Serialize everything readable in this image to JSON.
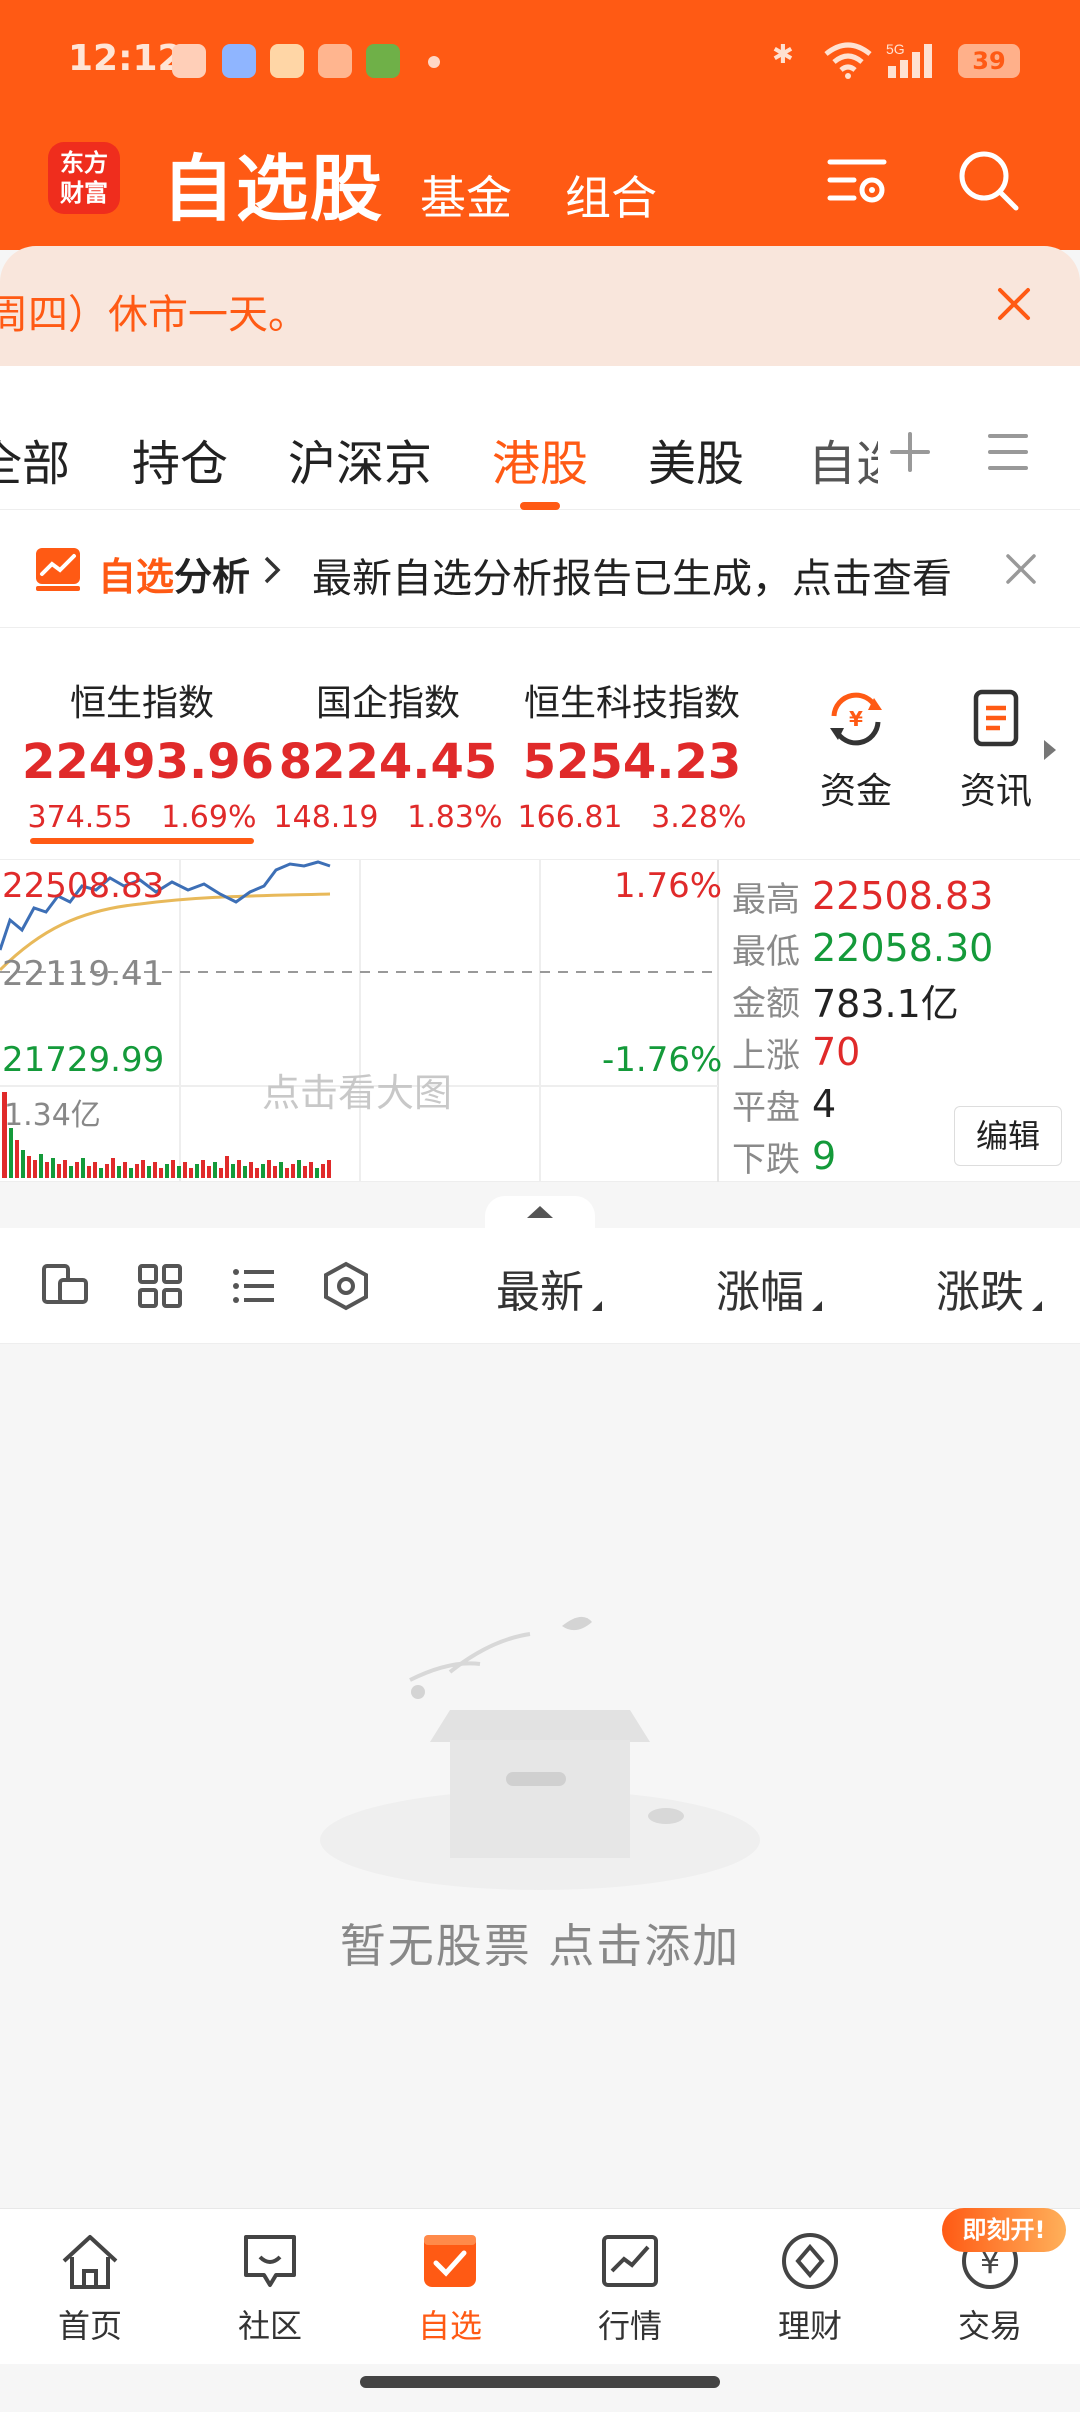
{
  "status_bar": {
    "time": "12:12",
    "battery": "39"
  },
  "header": {
    "logo": [
      "东方",
      "财富"
    ],
    "title": "自选股",
    "tabs": [
      "基金",
      "组合"
    ]
  },
  "notice": {
    "text": "周四）休市一天。"
  },
  "tabs": {
    "items": [
      "全部",
      "持仓",
      "沪深京",
      "港股",
      "美股",
      "自选"
    ],
    "active": "港股"
  },
  "analysis": {
    "title_accent": "自选",
    "title_rest": "分析",
    "message": "最新自选分析报告已生成，点击查看"
  },
  "indices": [
    {
      "name": "恒生指数",
      "value": "22493.96",
      "change": "374.55",
      "percent": "1.69%"
    },
    {
      "name": "国企指数",
      "value": "8224.45",
      "change": "148.19",
      "percent": "1.83%"
    },
    {
      "name": "恒生科技指数",
      "value": "5254.23",
      "change": "166.81",
      "percent": "3.28%"
    }
  ],
  "quick_actions": [
    {
      "label": "资金",
      "icon": "yuan-cycle-icon"
    },
    {
      "label": "资讯",
      "icon": "document-icon"
    }
  ],
  "chart": {
    "top_price": "22508.83",
    "mid_price": "22119.41",
    "bottom_price": "21729.99",
    "top_pct": "1.76%",
    "bottom_pct": "-1.76%",
    "volume": "1.34亿",
    "overlay_text": "点击看大图",
    "colors": {
      "up": "#e02a2a",
      "down": "#149a3a",
      "line": "#3d6fb6",
      "avg": "#e8b95a"
    }
  },
  "stats": {
    "high_label": "最高",
    "high": "22508.83",
    "low_label": "最低",
    "low": "22058.30",
    "amount_label": "金额",
    "amount": "783.1亿",
    "up_label": "上涨",
    "up": "70",
    "flat_label": "平盘",
    "flat": "4",
    "down_label": "下跌",
    "down": "9",
    "edit_label": "编辑"
  },
  "toolbar": {
    "sort": [
      "最新",
      "涨幅",
      "涨跌"
    ]
  },
  "empty": {
    "text": "暂无股票  点击添加"
  },
  "bottom_nav": {
    "items": [
      {
        "label": "首页",
        "icon": "home-icon"
      },
      {
        "label": "社区",
        "icon": "chat-icon"
      },
      {
        "label": "自选",
        "icon": "checklist-icon"
      },
      {
        "label": "行情",
        "icon": "chart-icon"
      },
      {
        "label": "理财",
        "icon": "diamond-icon"
      },
      {
        "label": "交易",
        "icon": "yuan-icon"
      }
    ],
    "active": "自选",
    "promo": "即刻开!"
  }
}
